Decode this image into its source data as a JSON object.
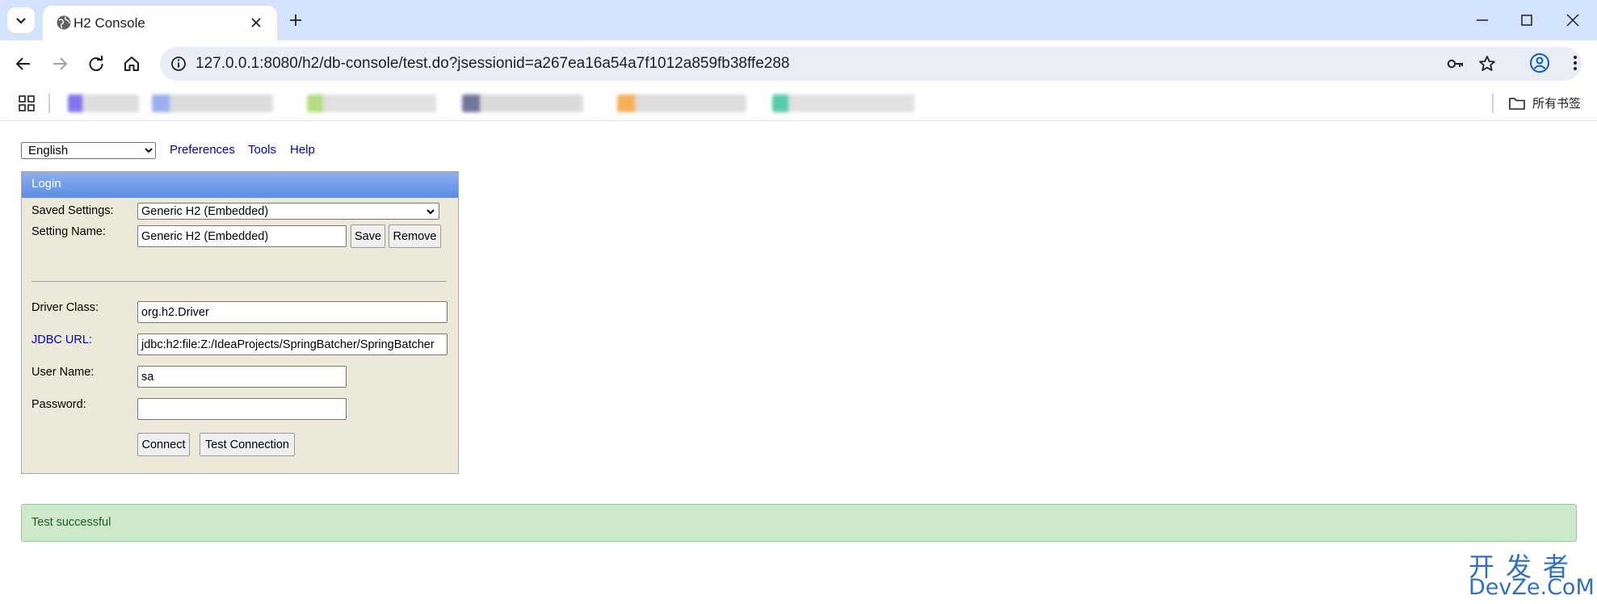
{
  "browser": {
    "tab_title": "H2 Console",
    "url": "127.0.0.1:8080/h2/db-console/test.do?jsessionid=a267ea16a54a7f1012a859fb38ffe288",
    "bookmarks_folder_label": "所有书签",
    "bookmark_colors": [
      "#6d5ce8",
      "#8aa0f0",
      "#a6d86c",
      "#5a5f8c",
      "#f4a340",
      "#38c49a"
    ]
  },
  "toolbar": {
    "language_selected": "English",
    "links": [
      "Preferences",
      "Tools",
      "Help"
    ]
  },
  "login": {
    "header": "Login",
    "saved_settings_label": "Saved Settings:",
    "saved_settings_value": "Generic H2 (Embedded)",
    "setting_name_label": "Setting Name:",
    "setting_name_value": "Generic H2 (Embedded)",
    "save_label": "Save",
    "remove_label": "Remove",
    "driver_class_label": "Driver Class:",
    "driver_class_value": "org.h2.Driver",
    "jdbc_url_label": "JDBC URL:",
    "jdbc_url_value": "jdbc:h2:file:Z:/IdeaProjects/SpringBatcher/SpringBatcher",
    "user_name_label": "User Name:",
    "user_name_value": "sa",
    "password_label": "Password:",
    "password_value": "",
    "connect_label": "Connect",
    "test_connection_label": "Test Connection"
  },
  "status": {
    "message": "Test successful"
  },
  "watermark": {
    "cn": "开发者",
    "en": "DevZe.CoM"
  }
}
